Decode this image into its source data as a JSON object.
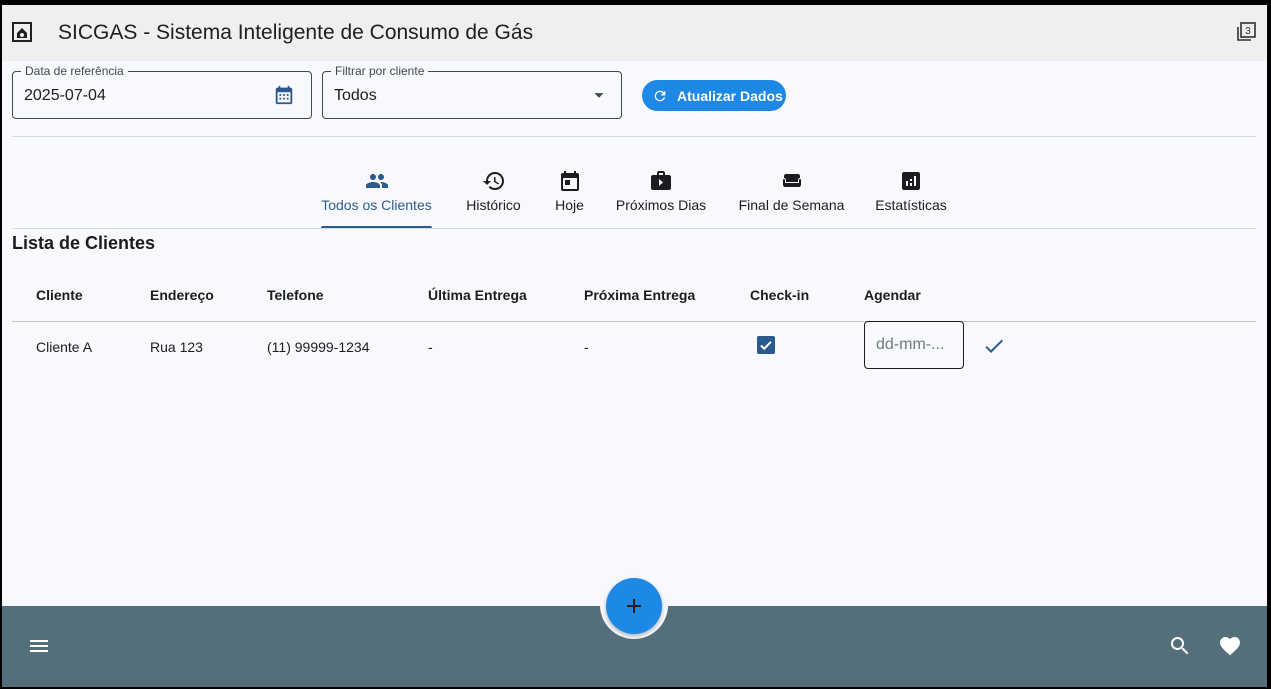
{
  "app": {
    "title": "SICGAS - Sistema Inteligente de Consumo de Gás",
    "window_badge": "3"
  },
  "filters": {
    "date": {
      "label": "Data de referência",
      "value": "2025-07-04"
    },
    "client": {
      "label": "Filtrar por cliente",
      "value": "Todos"
    },
    "refresh_label": "Atualizar Dados"
  },
  "tabs": [
    {
      "label": "Todos os Clientes",
      "icon": "people-icon",
      "active": true
    },
    {
      "label": "Histórico",
      "icon": "history-icon",
      "active": false
    },
    {
      "label": "Hoje",
      "icon": "calendar-today-icon",
      "active": false
    },
    {
      "label": "Próximos Dias",
      "icon": "briefcase-next-icon",
      "active": false
    },
    {
      "label": "Final de Semana",
      "icon": "sofa-icon",
      "active": false
    },
    {
      "label": "Estatísticas",
      "icon": "bar-chart-icon",
      "active": false
    }
  ],
  "section_title": "Lista de Clientes",
  "table": {
    "headers": [
      "Cliente",
      "Endereço",
      "Telefone",
      "Última Entrega",
      "Próxima Entrega",
      "Check-in",
      "Agendar"
    ],
    "rows": [
      {
        "cliente": "Cliente A",
        "endereco": "Rua 123",
        "telefone": "(11) 99999-1234",
        "ultima_entrega": "-",
        "proxima_entrega": "-",
        "checkin": true,
        "agendar_placeholder": "dd-mm-..."
      }
    ]
  },
  "colors": {
    "primary": "#1e88e5",
    "accent": "#2d5a8e",
    "bottom_bar": "#546e7a",
    "background": "#f7f9ff"
  }
}
